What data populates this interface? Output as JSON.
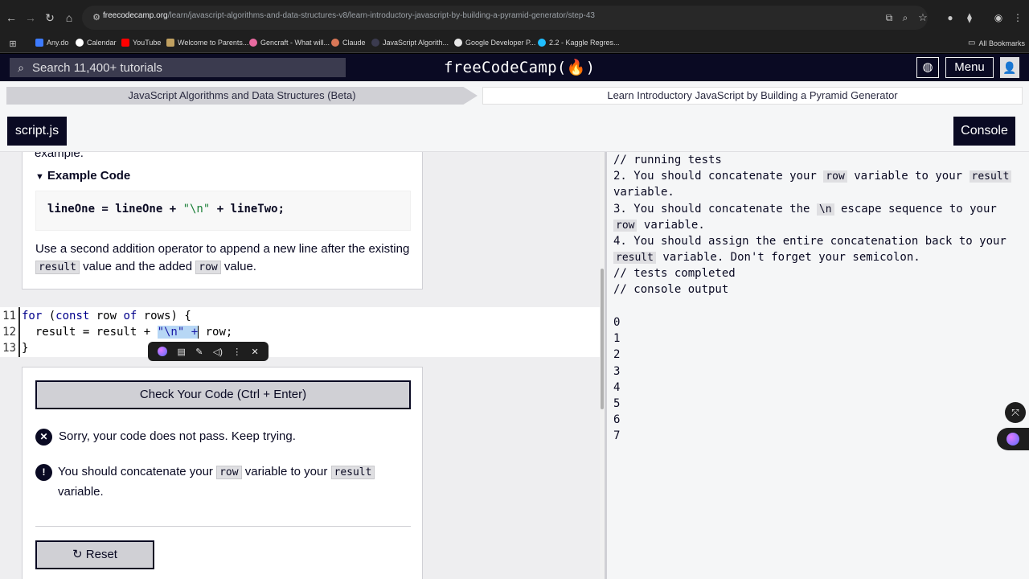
{
  "browser": {
    "url_host": "freecodecamp.org",
    "url_path": "/learn/javascript-algorithms-and-data-structures-v8/learn-introductory-javascript-by-building-a-pyramid-generator/step-43",
    "bookmarks": [
      "Any.do",
      "Calendar",
      "YouTube",
      "Welcome to Parents...",
      "Gencraft - What will...",
      "Claude",
      "JavaScript Algorith...",
      "Google Developer P...",
      "2.2 - Kaggle Regres...",
      "All Bookmarks"
    ]
  },
  "nav": {
    "search_placeholder": "Search 11,400+ tutorials",
    "logo": "freeCodeCamp(🔥)",
    "menu_label": "Menu"
  },
  "breadcrumb": {
    "superblock": "JavaScript Algorithms and Data Structures (Beta)",
    "block": "Learn Introductory JavaScript by Building a Pyramid Generator"
  },
  "toolbar": {
    "file_tab": "script.js",
    "console_tab": "Console"
  },
  "description": {
    "cut_text": "example.",
    "example_toggle": "Example Code",
    "example_code_a": "lineOne = lineOne + ",
    "example_code_str": "\"\\n\"",
    "example_code_b": " + lineTwo;",
    "instruction_a": "Use a second addition operator to append a new line after the existing",
    "code_result": "result",
    "instruction_b": "value and the added",
    "code_row": "row",
    "instruction_c": "value."
  },
  "editor": {
    "lines": [
      {
        "num": "11"
      },
      {
        "num": "12"
      },
      {
        "num": "13",
        "text": "}"
      }
    ],
    "line11_kw1": "for",
    "line11_rest1": " (",
    "line11_kw2": "const",
    "line11_rest2": " row ",
    "line11_kw3": "of",
    "line11_rest3": " rows) {",
    "line12_a": "  result = result + ",
    "line12_sel": "\"\\n\" +",
    "line12_b": " row;"
  },
  "results": {
    "check_button": "Check Your Code (Ctrl + Enter)",
    "fail_message": "Sorry, your code does not pass. Keep trying.",
    "hint_a": "You should concatenate your",
    "hint_row": "row",
    "hint_b": "variable to your",
    "hint_result": "result",
    "hint_c": "variable.",
    "reset_button": "Reset"
  },
  "console": {
    "l1": "// running tests",
    "l2a": "2. You should concatenate your ",
    "l2row": "row",
    "l2b": " variable to your ",
    "l2res": "result",
    "l3": "variable.",
    "l4a": "3. You should concatenate the ",
    "l4n": "\\n",
    "l4b": " escape sequence to your",
    "l5row": "row",
    "l5b": " variable.",
    "l6": "4. You should assign the entire concatenation back to your",
    "l7res": "result",
    "l7b": " variable. Don't forget your semicolon.",
    "l8": "// tests completed",
    "l9": "// console output",
    "outputs": [
      "0",
      "1",
      "2",
      "3",
      "4",
      "5",
      "6",
      "7"
    ]
  }
}
